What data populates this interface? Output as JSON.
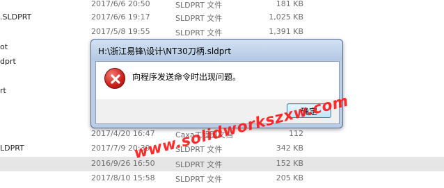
{
  "files": [
    {
      "name": "",
      "date": "2017/6/6 20:50",
      "type": "SLDPRT 文件",
      "size": "181 KB"
    },
    {
      "name": ".SLDPRT",
      "date": "2017/6/6 19:17",
      "type": "SLDPRT 文件",
      "size": "1,025 KB"
    },
    {
      "name": "",
      "date": "2017/5/8 19:55",
      "type": "SLDPRT 文件",
      "size": "1,391 KB"
    },
    {
      "name": "ot",
      "date": "",
      "type": "",
      "size": ""
    },
    {
      "name": "dprt",
      "date": "",
      "type": "",
      "size": ""
    },
    {
      "name": "",
      "date": "",
      "type": "",
      "size": ""
    },
    {
      "name": "rt",
      "date": "",
      "type": "",
      "size": ""
    },
    {
      "name": "",
      "date": "",
      "type": "",
      "size": ""
    },
    {
      "name": "",
      "date": "2017/4/20 16:47",
      "type": "Caxa工程图文档",
      "size": "112"
    },
    {
      "name": "LDPRT",
      "date": "2017/7/9 20:39",
      "type": "SLDPRT 文件",
      "size": "342 KB"
    },
    {
      "name": "",
      "date": "2016/9/26 16:50",
      "type": "SLDPRT 文件",
      "size": "152 KB"
    },
    {
      "name": "",
      "date": "2017/8/10 15:58",
      "type": "SLDPRT 文件",
      "size": "205 KB"
    }
  ],
  "dialog": {
    "title": "H:\\浙江易锋\\设计\\NT30刀柄.sldprt",
    "message": "向程序发送命令时出现问题。",
    "ok_label": "确定",
    "icon": "error-icon"
  },
  "watermark": "www.solidworkszxw.com"
}
